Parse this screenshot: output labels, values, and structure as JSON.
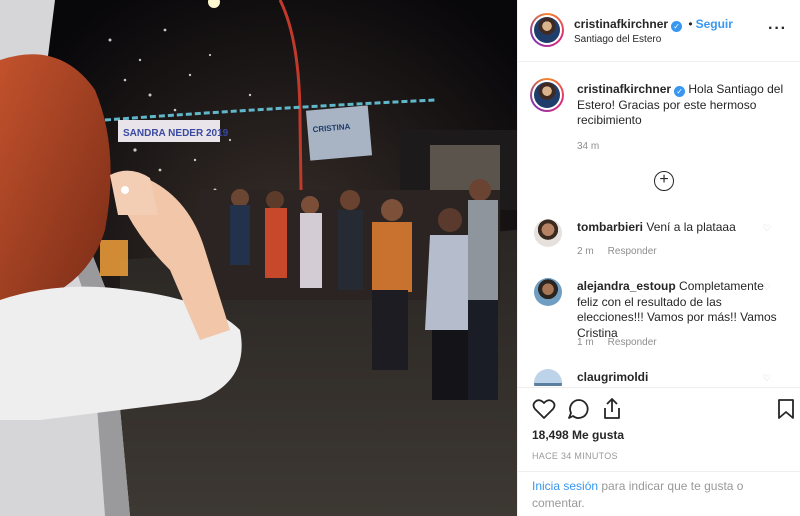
{
  "post": {
    "author": "cristinafkirchner",
    "follow_label": "Seguir",
    "location": "Santiago del Estero",
    "more_icon": "more-horizontal-icon",
    "banners": [
      "SANDRA NEDER 2019",
      "CRISTINA"
    ]
  },
  "caption": {
    "username": "cristinafkirchner",
    "text": "Hola Santiago del Estero! Gracias por este hermoso recibimiento",
    "time": "34 m"
  },
  "load_more_icon": "plus-circle-icon",
  "comments": [
    {
      "username": "tombarbieri",
      "text": "Vení a la plataaa",
      "time": "2 m",
      "reply": "Responder"
    },
    {
      "username": "alejandra_estoup",
      "text": "Completamente feliz con el resultado de las elecciones!!! Vamos por más!! Vamos Cristina",
      "time": "1 m",
      "reply": "Responder"
    },
    {
      "username": "claugrimoldi",
      "text": "",
      "time": "",
      "reply": ""
    }
  ],
  "actions": {
    "icons": [
      "heart-icon",
      "comment-icon",
      "share-icon",
      "bookmark-icon"
    ],
    "likes": "18,498 Me gusta",
    "timestamp": "HACE 34 MINUTOS"
  },
  "login": {
    "link": "Inicia sesión",
    "text": " para indicar que te gusta o comentar."
  },
  "colors": {
    "accent": "#3897f0",
    "text": "#262626",
    "muted": "#8e8e8e",
    "border": "#efefef"
  }
}
